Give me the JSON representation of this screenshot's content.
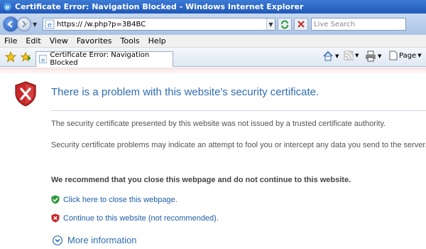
{
  "window": {
    "title": "Certificate Error: Navigation Blocked - Windows Internet Explorer"
  },
  "address": {
    "url": "https://                    /w.php?p=3B4BC",
    "search_placeholder": "Live Search"
  },
  "menu": {
    "items": [
      "File",
      "Edit",
      "View",
      "Favorites",
      "Tools",
      "Help"
    ]
  },
  "tab": {
    "title": "Certificate Error: Navigation Blocked"
  },
  "commandbar": {
    "page_label": "Page"
  },
  "content": {
    "heading": "There is a problem with this website's security certificate.",
    "para1": "The security certificate presented by this website was not issued by a trusted certificate authority.",
    "para2": "Security certificate problems may indicate an attempt to fool you or intercept any data you send to the server.",
    "recommendation": "We recommend that you close this webpage and do not continue to this website.",
    "close_link": "Click here to close this webpage.",
    "continue_link": "Continue to this website (not recommended).",
    "more_info": "More information"
  },
  "colors": {
    "heading": "#2e6db2",
    "link": "#1f5fa8",
    "shield_red": "#c62828",
    "shield_green": "#2e9b3a"
  }
}
